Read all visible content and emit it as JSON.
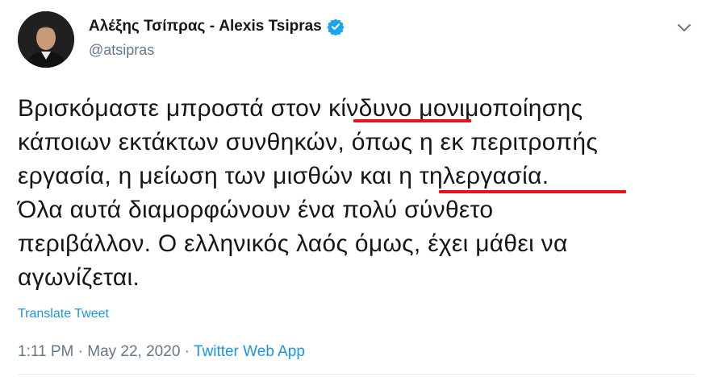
{
  "author": {
    "display_name": "Αλέξης Τσίπρας - Alexis Tsipras",
    "handle": "@atsipras",
    "verified": true,
    "avatar_icon": "profile-photo-icon"
  },
  "tweet": {
    "lines": [
      "Βρισκόμαστε μπροστά στον κίνδυνο μονιμοποίησης",
      "κάποιων εκτάκτων συνθηκών, όπως η εκ περιτροπής",
      "εργασία, η μείωση των μισθών και η τηλεργασία.",
      "Όλα αυτά διαμορφώνουν ένα πολύ σύνθετο",
      "περιβάλλον. Ο ελληνικός λαός όμως, έχει μάθει να",
      "αγωνίζεται."
    ],
    "highlight_color": "#e8131b"
  },
  "translate_label": "Translate Tweet",
  "meta": {
    "time": "1:11 PM",
    "separator": "·",
    "date": "May 22, 2020",
    "source": "Twitter Web App"
  },
  "colors": {
    "link": "#1b95e0",
    "secondary_text": "#657786",
    "verified": "#1da1f2"
  }
}
